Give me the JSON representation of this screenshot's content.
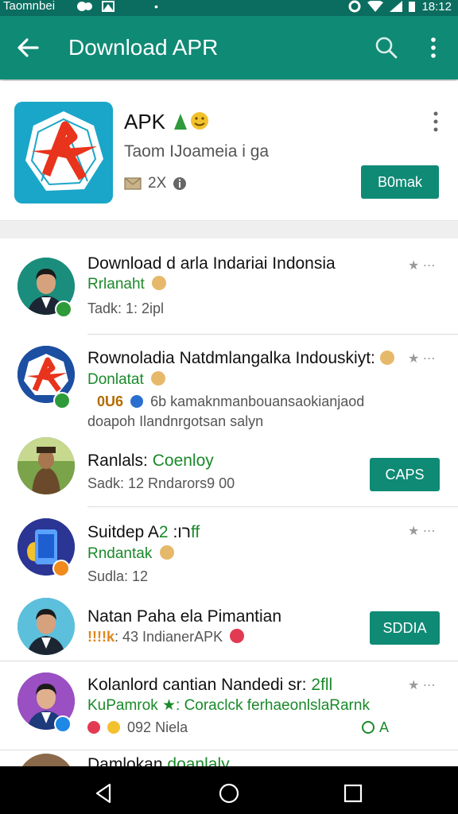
{
  "statusbar": {
    "left_text": "Taomnbei",
    "time": "18:12",
    "bg_color": "#0a6d5f"
  },
  "appbar": {
    "title": "Download APR",
    "bg_color": "#0f8a75",
    "icons": [
      "back-arrow-icon",
      "search-icon",
      "more-vert-icon"
    ]
  },
  "featured": {
    "title": "APK",
    "subtitle": "Taom IJoameia i ga",
    "meta": "2X",
    "button_label": "B0mak",
    "icons": [
      "logo-icon",
      "emoji-icon",
      "mail-icon",
      "info-icon",
      "more-vert-icon"
    ]
  },
  "items": [
    {
      "title": "Download d arla Indariai Indonsia",
      "subtitle": "Rrlanaht",
      "meta": "Tadk: 1: 2ipl",
      "action": "star"
    },
    {
      "title": "Rownoladia Natdmlangalka Indouskiyt:",
      "subtitle": "Donlatat",
      "meta": "6b kamaknmanbouansaokianjaod",
      "meta_prefix": "0U6",
      "meta2": "doapoh Ilandnrgotsan salyn",
      "action": "star"
    },
    {
      "title": "Ranlals:",
      "title_accent": "Coenloy",
      "meta": "Sadk: 12 Rndarors9 00",
      "action": "button",
      "button_label": "CAPS"
    },
    {
      "title": "Suitdep Aרו:",
      "title_accent": "2ff",
      "subtitle": "Rndantak",
      "meta": "Sudla: 12",
      "action": "star"
    },
    {
      "title": "Natan Paha ela Pimantian",
      "subtitle_prefix": "!!!!k",
      "meta": ": 43 IndianerAPK",
      "action": "button",
      "button_label": "SDDIA"
    },
    {
      "title": "Kolanlord cantian Nandedi sr:",
      "title_accent": "2fll",
      "subtitle": "KuPamrok ★: Coraclck ferhaeonlslaRarnk",
      "meta": "092 Niela",
      "meta_right": "A",
      "action": "star"
    },
    {
      "title": "Damlokan",
      "title_accent": "doanlaly"
    }
  ],
  "colors": {
    "primary": "#0f8a75",
    "primary_dark": "#0a6d5f",
    "subtitle_green": "#1a8a2a",
    "navbar": "#000000"
  },
  "navbar": {
    "icons": [
      "back-triangle-icon",
      "home-circle-icon",
      "recents-square-icon"
    ]
  }
}
